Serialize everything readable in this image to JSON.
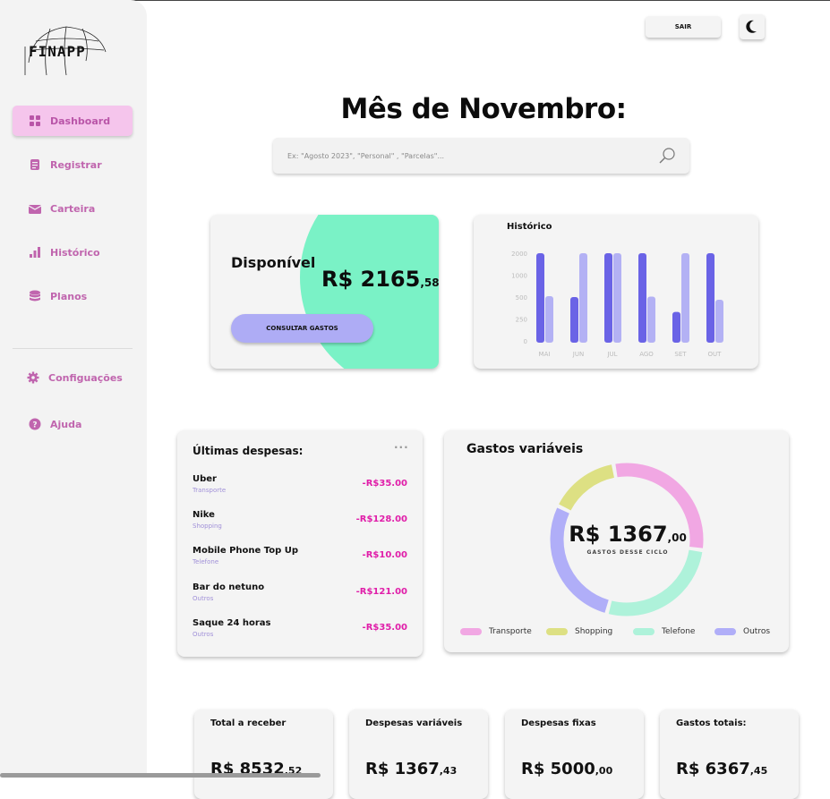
{
  "app": {
    "logo_text": "FINAPP"
  },
  "sidebar": {
    "items": [
      {
        "label": "Dashboard",
        "icon": "grid-icon",
        "active": true
      },
      {
        "label": "Registrar",
        "icon": "document-icon"
      },
      {
        "label": "Carteira",
        "icon": "wallet-icon"
      },
      {
        "label": "Histórico",
        "icon": "bar-chart-icon"
      },
      {
        "label": "Planos",
        "icon": "database-icon"
      }
    ],
    "footer": [
      {
        "label": "Configuações",
        "icon": "gear-icon"
      },
      {
        "label": "Ajuda",
        "icon": "help-icon"
      }
    ]
  },
  "header": {
    "logout_label": "SAIR",
    "theme_icon": "moon-icon"
  },
  "main": {
    "title": "Mês de Novembro:",
    "search": {
      "placeholder": "Ex: \"Agosto 2023\", \"Personal\" , \"Parcelas\"..."
    }
  },
  "available": {
    "title": "Disponível",
    "amount_main": "R$ 2165",
    "amount_cents": ",58",
    "button_label": "CONSULTAR GASTOS"
  },
  "chart_data": [
    {
      "type": "bar",
      "title": "Histórico",
      "categories": [
        "MAI",
        "JUN",
        "JUL",
        "AGO",
        "SET",
        "OUT"
      ],
      "yticks": [
        "0",
        "250",
        "500",
        "1000",
        "2000"
      ],
      "series": [
        {
          "values": [
            2000,
            500,
            2000,
            2000,
            330,
            2000
          ],
          "color": "#6a63e6"
        },
        {
          "values": [
            520,
            2000,
            2000,
            510,
            2000,
            470
          ],
          "color": "#b3b1f4"
        }
      ]
    },
    {
      "type": "pie",
      "title": "Gastos variáveis",
      "center_main": "R$ 1367",
      "center_cents": ",00",
      "center_label": "GASTOS DESSE CICLO",
      "slices": [
        {
          "name": "Transporte",
          "value": 30,
          "color": "#f1a7e3"
        },
        {
          "name": "Shopping",
          "value": 15,
          "color": "#dde083"
        },
        {
          "name": "Telefone",
          "value": 27,
          "color": "#aef2da"
        },
        {
          "name": "Outros",
          "value": 28,
          "color": "#b0aef8"
        }
      ]
    }
  ],
  "expenses": {
    "title": "Últimas despesas:",
    "more": "···",
    "items": [
      {
        "name": "Uber",
        "category": "Transporte",
        "value": "-R$35.00"
      },
      {
        "name": "Nike",
        "category": "Shopping",
        "value": "-R$128.00"
      },
      {
        "name": "Mobile Phone Top Up",
        "category": "Telefone",
        "value": "-R$10.00"
      },
      {
        "name": "Bar do netuno",
        "category": "Outros",
        "value": "-R$121.00"
      },
      {
        "name": "Saque 24 horas",
        "category": "Outros",
        "value": "-R$35.00"
      }
    ]
  },
  "summary": [
    {
      "title": "Total a receber",
      "main": "R$ 8532",
      "cents": ",52"
    },
    {
      "title": "Despesas variáveis",
      "main": "R$ 1367",
      "cents": ",43"
    },
    {
      "title": "Despesas fixas",
      "main": "R$ 5000",
      "cents": ",00"
    },
    {
      "title": "Gastos totais:",
      "main": "R$ 6367",
      "cents": ",45"
    }
  ]
}
